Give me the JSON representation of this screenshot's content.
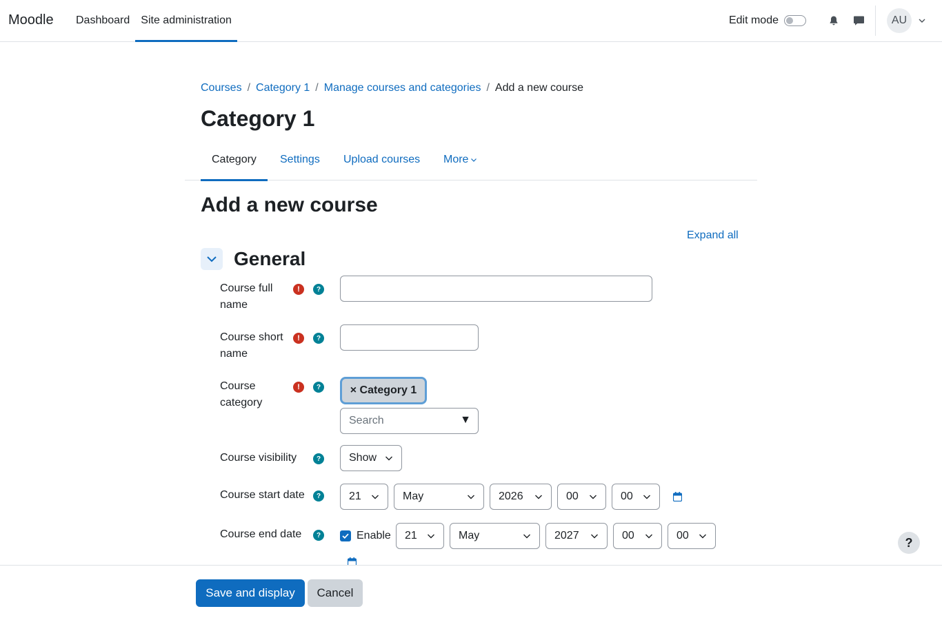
{
  "navbar": {
    "brand": "Moodle",
    "items": [
      {
        "label": "Dashboard",
        "active": false
      },
      {
        "label": "Site administration",
        "active": true
      }
    ],
    "edit_mode_label": "Edit mode",
    "edit_mode_on": false,
    "user_initials": "AU"
  },
  "breadcrumb": [
    "Courses",
    "Category 1",
    "Manage courses and categories",
    "Add a new course"
  ],
  "page_title": "Category 1",
  "secondary_nav": {
    "tabs": [
      "Category",
      "Settings",
      "Upload courses",
      "More"
    ],
    "active": "Category"
  },
  "form": {
    "title": "Add a new course",
    "expand_all": "Expand all",
    "section_title": "General",
    "fields": {
      "full_name": {
        "label": "Course full name",
        "value": ""
      },
      "short_name": {
        "label": "Course short name",
        "value": ""
      },
      "category": {
        "label": "Course category",
        "selected": "× Category 1",
        "search_placeholder": "Search",
        "search_arrow": "▼"
      },
      "visibility": {
        "label": "Course visibility",
        "value": "Show"
      },
      "start_date": {
        "label": "Course start date",
        "day": "21",
        "month": "May",
        "year": "2026",
        "hour": "00",
        "minute": "00"
      },
      "end_date": {
        "label": "Course end date",
        "enable_label": "Enable",
        "enabled": true,
        "day": "21",
        "month": "May",
        "year": "2027",
        "hour": "00",
        "minute": "00"
      }
    }
  },
  "help_button": "?",
  "footer": {
    "save_label": "Save and display",
    "cancel_label": "Cancel"
  },
  "colors": {
    "accent": "#0f6cbf",
    "required": "#ca3120",
    "help": "#008196"
  }
}
